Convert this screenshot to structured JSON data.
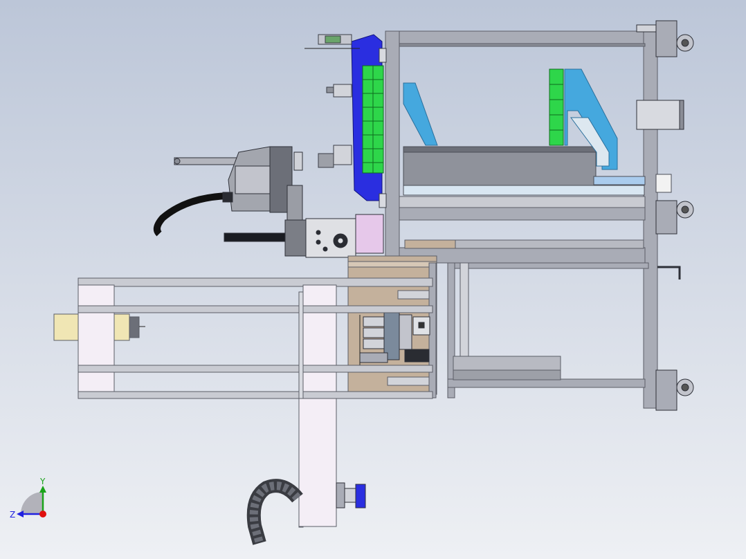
{
  "viewport": {
    "background_top": "#bcc6d8",
    "background_bottom": "#eef0f4"
  },
  "colors": {
    "frame": "#a9acb6",
    "frame_dark": "#5a5d66",
    "plate_blue": "#2a2ee0",
    "grid_green": "#2ed64a",
    "bracket_cyan": "#45a8de",
    "tan_plate": "#c4b19c",
    "pink_block": "#e6c8ea",
    "light_pink": "#f4eef6",
    "cream": "#f0e6b4"
  },
  "triad": {
    "y_label": "Y",
    "z_label": "Z",
    "y_color": "#19a319",
    "z_color": "#2020e0",
    "origin_color": "#e01010"
  }
}
